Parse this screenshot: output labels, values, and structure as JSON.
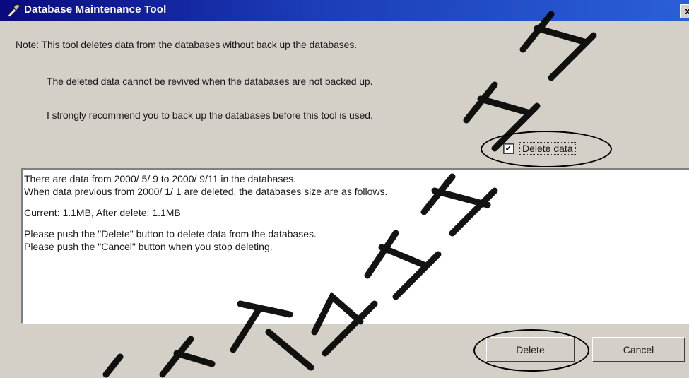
{
  "window": {
    "title": "Database Maintenance Tool",
    "close_glyph": "x",
    "colors": {
      "title_bar": "#1c3cb8",
      "background": "#d4d0c8"
    }
  },
  "notes": [
    "Note: This tool deletes data from the databases without back up the databases.",
    "The deleted data cannot be revived when the databases are not backed up.",
    "I strongly recommend you to back up the databases before this tool is used."
  ],
  "delete_checkbox": {
    "label": "Delete data",
    "checked": true,
    "check_glyph": "✓"
  },
  "info": {
    "lines": [
      "There are data from 2000/ 5/ 9 to 2000/ 9/11 in the databases.",
      "When data previous from 2000/ 1/ 1 are deleted, the databases size are as follows.",
      "",
      "Current:  1.1MB,  After delete:  1.1MB",
      "",
      "Please push the \"Delete\" button to delete data from the databases.",
      "Please push the \"Cancel\" button when you stop deleting."
    ]
  },
  "buttons": {
    "delete_label": "Delete",
    "cancel_label": "Cancel"
  },
  "icons": {
    "app_icon": "tool-icon",
    "close": "close-icon",
    "checkbox_mark": "check-icon"
  }
}
